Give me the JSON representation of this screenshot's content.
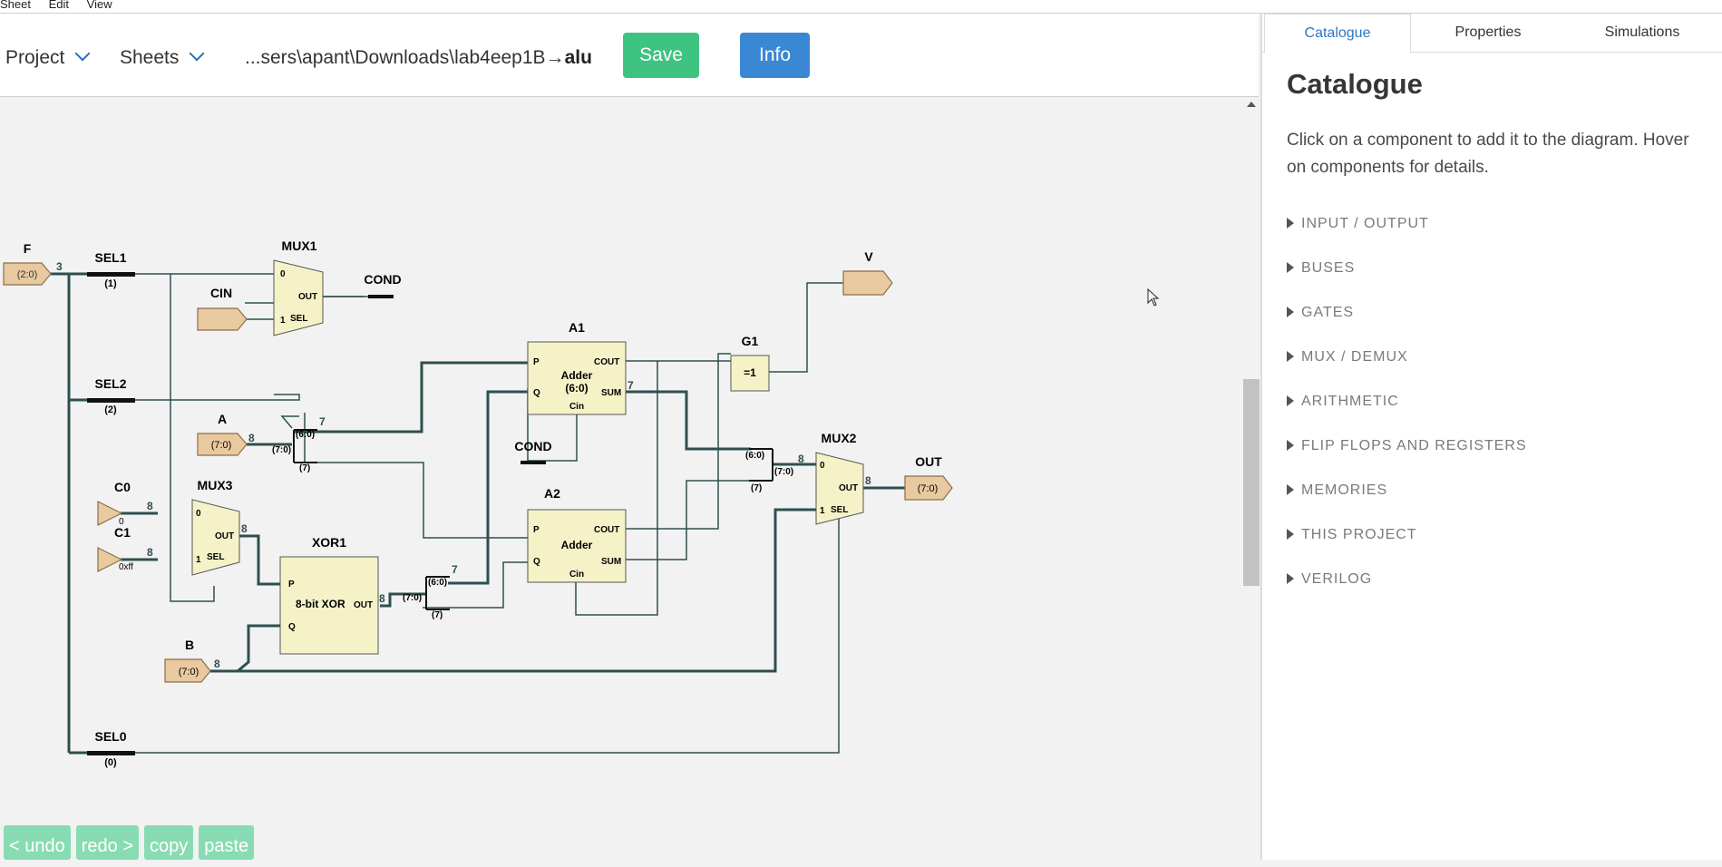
{
  "menubar": {
    "items": [
      "Sheet",
      "Edit",
      "View"
    ]
  },
  "toolbar": {
    "project_label": "Project",
    "sheets_label": "Sheets",
    "path_prefix": "...sers\\apant\\Downloads\\lab4eep1B",
    "path_arrow": "→",
    "path_sheet": "alu",
    "save_label": "Save",
    "info_label": "Info"
  },
  "panel": {
    "tabs": [
      "Catalogue",
      "Properties",
      "Simulations"
    ],
    "active_tab": "Catalogue",
    "title": "Catalogue",
    "description": "Click on a component to add it to the diagram. Hover on components for details.",
    "categories": [
      "INPUT / OUTPUT",
      "BUSES",
      "GATES",
      "MUX / DEMUX",
      "ARITHMETIC",
      "FLIP FLOPS AND REGISTERS",
      "MEMORIES",
      "THIS PROJECT",
      "VERILOG"
    ]
  },
  "edit_buttons": {
    "undo": "< undo",
    "redo": "redo >",
    "copy": "copy",
    "paste": "paste"
  },
  "diagram": {
    "labels": {
      "F": "F",
      "F_range": "(2:0)",
      "F_width": "3",
      "SEL1": "SEL1",
      "SEL1_bit": "(1)",
      "SEL2": "SEL2",
      "SEL2_bit": "(2)",
      "SEL0": "SEL0",
      "SEL0_bit": "(0)",
      "MUX1": "MUX1",
      "CIN": "CIN",
      "COND_out": "COND",
      "COND_in": "COND",
      "A": "A",
      "A_range": "(7:0)",
      "A_width": "8",
      "C0": "C0",
      "C0_val": "0",
      "C0_w": "8",
      "C1": "C1",
      "C1_val": "0xff",
      "C1_w": "8",
      "MUX3": "MUX3",
      "MUX3_w": "8",
      "XOR1": "XOR1",
      "XOR1_body": "8-bit XOR",
      "XOR1_w": "8",
      "B": "B",
      "B_range": "(7:0)",
      "B_width": "8",
      "A1": "A1",
      "A1_body1": "Adder",
      "A1_body2": "(6:0)",
      "A1_sum_w": "7",
      "A2": "A2",
      "A2_body": "Adder",
      "G1": "G1",
      "G1_body": "=1",
      "V": "V",
      "MUX2": "MUX2",
      "MUX2_w": "8",
      "MUX2_in_w": "8",
      "OUT": "OUT",
      "OUT_range": "(7:0)",
      "split_a_top": "7",
      "split_a_hi": "(6:0)",
      "split_a_in": "(7:0)",
      "split_a_lo": "(7)",
      "split_b_top": "7",
      "split_b_hi": "(6:0)",
      "split_b_in": "(7:0)",
      "split_b_lo": "(7)",
      "merge_hi": "(6:0)",
      "merge_out": "(7:0)",
      "merge_lo": "(7)",
      "port_P": "P",
      "port_Q": "Q",
      "port_COUT": "COUT",
      "port_SUM": "SUM",
      "port_Cin": "Cin",
      "port_OUT": "OUT",
      "port_SEL": "SEL",
      "port_0": "0",
      "port_1": "1"
    }
  }
}
